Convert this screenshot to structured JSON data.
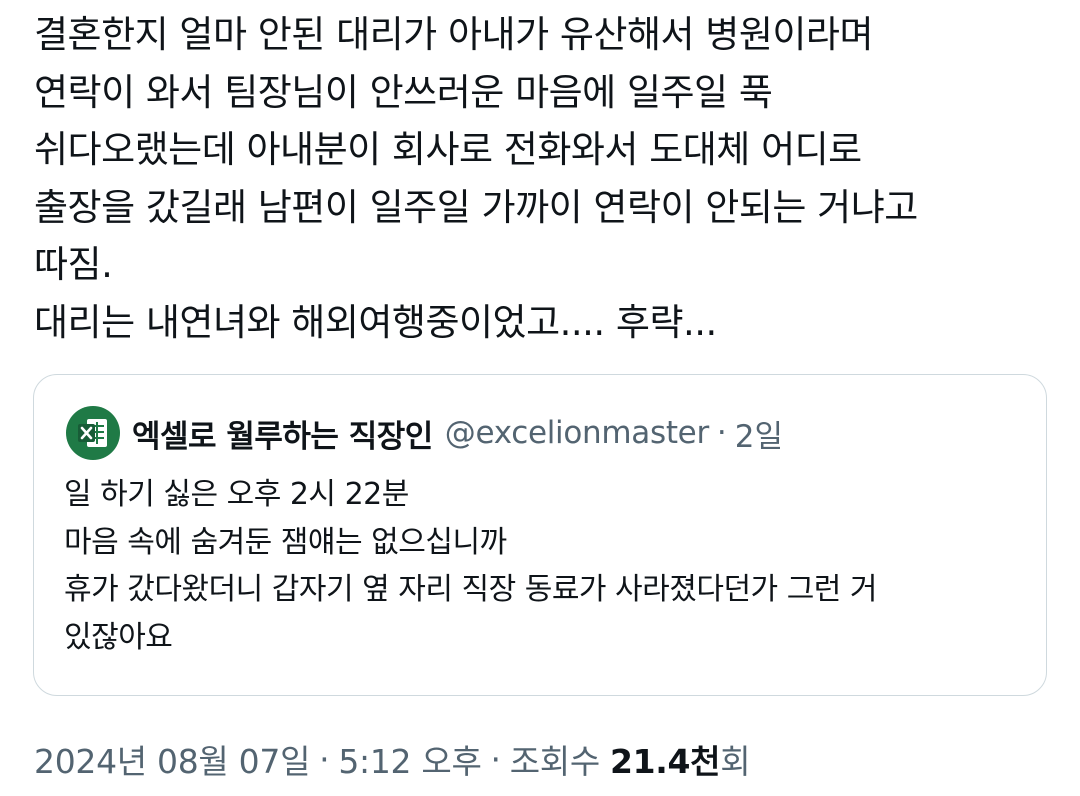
{
  "tweet": {
    "lines": [
      "결혼한지 얼마 안된 대리가 아내가 유산해서 병원이라며",
      "연락이 와서 팀장님이 안쓰러운 마음에 일주일 푹",
      "쉬다오랬는데 아내분이 회사로 전화와서 도대체 어디로",
      "출장을 갔길래 남편이 일주일 가까이 연락이 안되는 거냐고",
      "따짐.",
      "대리는 내연녀와 해외여행중이었고.... 후략..."
    ]
  },
  "quote": {
    "avatar_icon": "excel-logo-icon",
    "author_name": "엑셀로 월루하는 직장인",
    "author_handle": "@excelionmaster",
    "separator": "·",
    "age": "2일",
    "lines": [
      "일 하기 싫은 오후 2시 22분",
      "마음 속에 숨겨둔 잼얘는 없으십니까",
      "휴가 갔다왔더니 갑자기 옆 자리 직장 동료가 사라졌다던가 그런 거",
      "있잖아요"
    ]
  },
  "meta": {
    "date": "2024년 08월 07일",
    "sep1": "·",
    "time": "5:12 오후",
    "sep2": "·",
    "views_label": "조회수",
    "views_count": "21.4천",
    "views_unit": "회"
  },
  "colors": {
    "text": "#0f1419",
    "secondary": "#536471",
    "border": "#cfd9de",
    "excel_green": "#1f7a46"
  }
}
